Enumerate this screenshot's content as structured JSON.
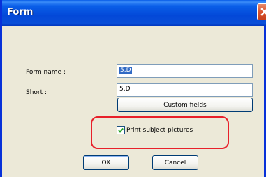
{
  "window": {
    "title": "Form",
    "close_icon": "close-icon"
  },
  "fields": {
    "form_name_label": "Form name :",
    "form_name_value": "5.D",
    "short_label": "Short :",
    "short_value": "5.D"
  },
  "buttons": {
    "custom_fields": "Custom fields",
    "ok": "OK",
    "cancel": "Cancel"
  },
  "options": {
    "print_subject_pictures_label": "Print subject pictures",
    "print_subject_pictures_checked": true
  },
  "colors": {
    "titlebar_blue": "#0a5fe8",
    "dialog_bg": "#ece9d8",
    "highlight_red": "#e8202a",
    "selection_blue": "#316ac5"
  }
}
